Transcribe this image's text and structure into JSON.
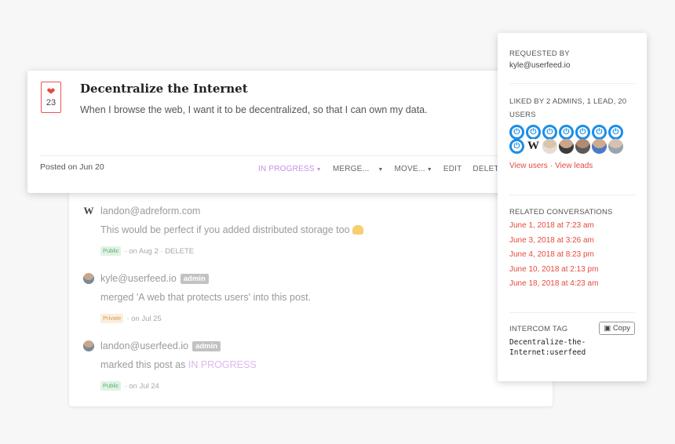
{
  "post": {
    "votes": "23",
    "title": "Decentralize the Internet",
    "description": "When I browse the web, I want it to be decentralized, so that I can own my data.",
    "posted": "Posted on Jun 20",
    "actions": {
      "status": "IN PROGRESS",
      "merge": "MERGE...",
      "move": "MOVE...",
      "edit": "EDIT",
      "delete": "DELETE"
    }
  },
  "comments": [
    {
      "author": "landon@adreform.com",
      "avatar_initial": "W",
      "body": "This would be perfect if you added distributed storage too",
      "visibility": "Public",
      "meta": "· on Aug 2 · DELETE"
    },
    {
      "author": "kyle@userfeed.io",
      "badge": "admin",
      "body": "merged 'A web that protects users' into this post.",
      "visibility": "Private",
      "meta": "· on Jul 25"
    },
    {
      "author": "landon@userfeed.io",
      "badge": "admin",
      "body_prefix": "marked this post as",
      "body_status": "IN PROGRESS",
      "visibility": "Public",
      "meta": "· on Jul 24"
    }
  ],
  "sidebar": {
    "requested_label": "REQUESTED BY",
    "requested_by": "kyle@userfeed.io",
    "liked_label": "LIKED BY 2 ADMINS, 1 LEAD, 20 USERS",
    "liked_w_initial": "W",
    "view_users": "View users",
    "view_leads": "View leads",
    "separator": "·",
    "related_label": "RELATED CONVERSATIONS",
    "conversations": [
      "June 1, 2018 at 7:23 am",
      "June 3, 2018 at 3:26 am",
      "June 4, 2018 at 8:23 pm",
      "June 10, 2018 at 2:13 pm",
      "June 18, 2018 at 4:23 am"
    ],
    "intercom_label": "INTERCOM TAG",
    "copy_label": "Copy",
    "intercom_tag_line1": "Decentralize-the-",
    "intercom_tag_line2": "Internet:userfeed"
  },
  "colors": {
    "accent_red": "#e54b3c",
    "status_purple": "#c78ee6",
    "power_blue": "#1b8ee6"
  }
}
